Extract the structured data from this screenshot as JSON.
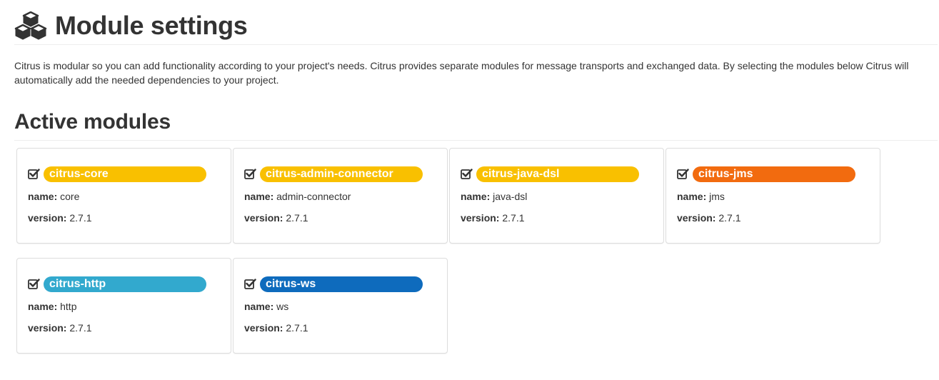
{
  "header": {
    "icon": "cubes-icon",
    "title": "Module settings"
  },
  "intro": "Citrus is modular so you can add functionality according to your project's needs. Citrus provides separate modules for message transports and exchanged data. By selecting the modules below Citrus will automatically add the needed dependencies to your project.",
  "active_modules": {
    "title": "Active modules",
    "name_label": "name:",
    "version_label": "version:",
    "check_icon": "checked-checkbox-icon",
    "modules": [
      {
        "label": "citrus-core",
        "name": "core",
        "version": "2.7.1",
        "color": "#f9c000"
      },
      {
        "label": "citrus-admin-connector",
        "name": "admin-connector",
        "version": "2.7.1",
        "color": "#f9c000"
      },
      {
        "label": "citrus-java-dsl",
        "name": "java-dsl",
        "version": "2.7.1",
        "color": "#f9c000"
      },
      {
        "label": "citrus-jms",
        "name": "jms",
        "version": "2.7.1",
        "color": "#f26b0f"
      },
      {
        "label": "citrus-http",
        "name": "http",
        "version": "2.7.1",
        "color": "#32a9ce"
      },
      {
        "label": "citrus-ws",
        "name": "ws",
        "version": "2.7.1",
        "color": "#0e6bbd"
      }
    ]
  }
}
